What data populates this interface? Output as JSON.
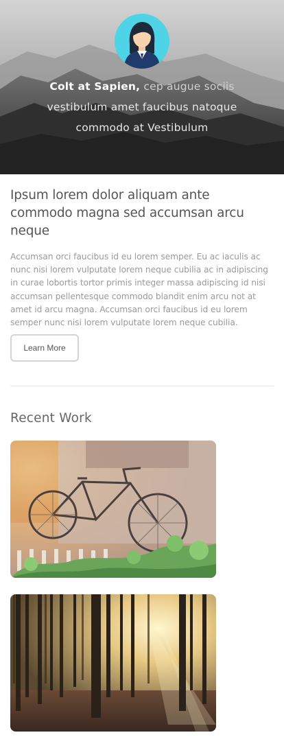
{
  "hero": {
    "avatar_icon": "woman-avatar-icon",
    "text_line1_strong": "Colt at Sapien,",
    "text_line1_rest": " cep augue sociis",
    "text_line2": "vestibulum amet faucibus natoque",
    "text_line3": "commodo at Vestibulum"
  },
  "intro": {
    "heading": "Ipsum lorem dolor aliquam ante commodo magna sed accumsan arcu neque",
    "body": "Accumsan orci faucibus id eu lorem semper. Eu ac iaculis ac nunc nisi lorem vulputate lorem neque cubilia ac in adipiscing in curae lobortis tortor primis integer massa adipiscing id nisi accumsan pellentesque commodo blandit enim arcu not at amet id arcu magna. Accumsan orci faucibus id eu lorem semper nunc nisi lorem vulputate lorem neque cubilia.",
    "button_label": "Learn More"
  },
  "recent_work": {
    "title": "Recent Work",
    "items": [
      {
        "subject": "bicycle-photo"
      },
      {
        "subject": "forest-photo"
      }
    ]
  },
  "colors": {
    "heading": "#555555",
    "body_text": "#9a9a9a",
    "avatar_bg": "#4fd3e6",
    "divider": "#e6e6e6"
  }
}
